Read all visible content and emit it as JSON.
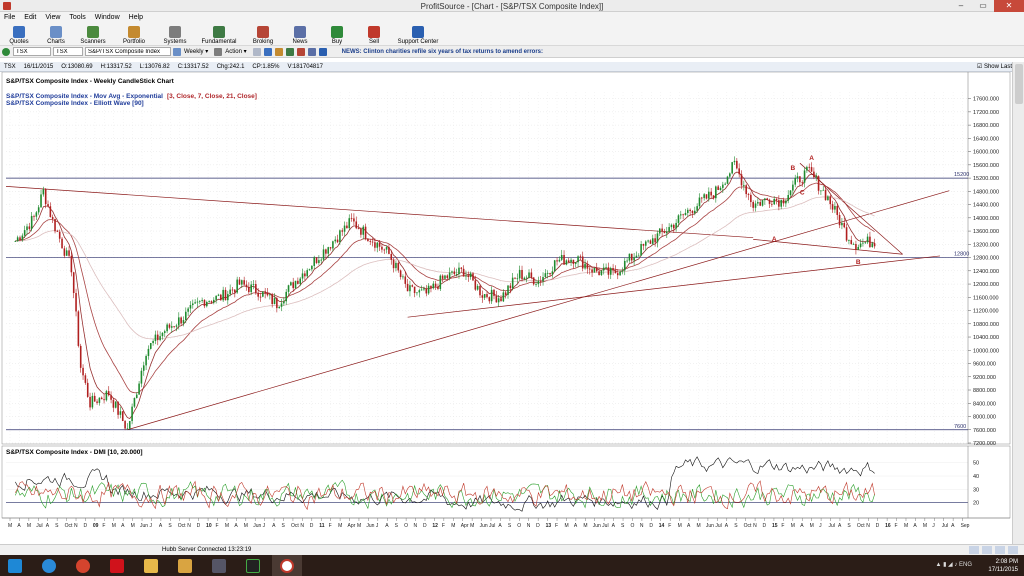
{
  "window": {
    "title": "ProfitSource - [Chart - [S&P/TSX Composite Index]]",
    "controls": [
      "–",
      "▭",
      "✕"
    ]
  },
  "menu": [
    "File",
    "Edit",
    "View",
    "Tools",
    "Window",
    "Help"
  ],
  "toolbar": [
    {
      "label": "Quotes",
      "color": "#3a6fbf"
    },
    {
      "label": "Charts",
      "color": "#6a8fc7"
    },
    {
      "label": "Scanners",
      "color": "#4b8a3e"
    },
    {
      "label": "Portfolio",
      "color": "#c48a2f"
    },
    {
      "label": "Systems",
      "color": "#7d7d7d"
    },
    {
      "label": "Fundamental",
      "color": "#3e7a44"
    },
    {
      "label": "Broking",
      "color": "#b64536"
    },
    {
      "label": "News",
      "color": "#5b6fa6"
    },
    {
      "label": "Buy",
      "color": "#2f8a3a"
    },
    {
      "label": "Sell",
      "color": "#c0392b"
    },
    {
      "label": "Support Center",
      "color": "#2a5fb0"
    }
  ],
  "searchbar": {
    "symbol_value": "TSX",
    "exchange_value": "TSX",
    "name_value": "S&P/TSX Composite Index",
    "period": "Weekly",
    "action": "Action",
    "news": "NEWS: Clinton charities refile six years of tax returns to amend errors:"
  },
  "infobar": {
    "symbol": "TSX",
    "date": "16/11/2015",
    "open": "O:13080.69",
    "high": "H:13317.52",
    "low": "L:13076.82",
    "close": "C:13317.52",
    "change": "Chg:242.1",
    "change_pct": "CP:1.85%",
    "volume": "V:181704817",
    "show_last": "Show Last"
  },
  "chart": {
    "title_lines": [
      "S&P/TSX Composite Index - Weekly CandleStick Chart",
      "S&P/TSX Composite Index - Mov Avg - Exponential",
      "S&P/TSX Composite Index - Elliott Wave [90]"
    ],
    "mavg_params": "[3, Close, 7, Close, 21, Close]",
    "y_ticks": [
      "17600.000",
      "17200.000",
      "16800.000",
      "16400.000",
      "16000.000",
      "15600.000",
      "15200.000",
      "14800.000",
      "14400.000",
      "14000.000",
      "13600.000",
      "13200.000",
      "12800.000",
      "12400.000",
      "12000.000",
      "11600.000",
      "11200.000",
      "10800.000",
      "10400.000",
      "10000.000",
      "9600.000",
      "9200.000",
      "8800.000",
      "8400.000",
      "8000.000",
      "7600.000",
      "7200.000"
    ],
    "level_labels": [
      "15200",
      "12800",
      "7600"
    ],
    "wave_labels": [
      "A",
      "B",
      "C",
      "A",
      "B"
    ],
    "dmi_title": "S&P/TSX Composite Index - DMI [10, 20.000]",
    "dmi_ticks": [
      "50",
      "40",
      "30",
      "20"
    ],
    "x_labels": [
      "M",
      "A",
      "M",
      "Jul",
      "A",
      "S",
      "Oct",
      "N",
      "D",
      "09",
      "F",
      "M",
      "A",
      "M",
      "Jun",
      "J",
      "A",
      "S",
      "Oct",
      "N",
      "D",
      "10",
      "F",
      "M",
      "A",
      "M",
      "Jun",
      "J",
      "A",
      "S",
      "Oct",
      "N",
      "D",
      "11",
      "F",
      "M",
      "Apr",
      "M",
      "Jun",
      "J",
      "A",
      "S",
      "O",
      "N",
      "D",
      "12",
      "F",
      "M",
      "Apr",
      "M",
      "Jun",
      "Jul",
      "A",
      "S",
      "O",
      "N",
      "D",
      "13",
      "F",
      "M",
      "A",
      "M",
      "Jun",
      "Jul",
      "A",
      "S",
      "O",
      "N",
      "D",
      "14",
      "F",
      "M",
      "A",
      "M",
      "Jun",
      "Jul",
      "A",
      "S",
      "Oct",
      "N",
      "D",
      "15",
      "F",
      "M",
      "A",
      "M",
      "J",
      "Jul",
      "A",
      "S",
      "Oct",
      "N",
      "D",
      "16",
      "F",
      "M",
      "A",
      "M",
      "J",
      "Jul",
      "A",
      "Sep"
    ],
    "bold_years": [
      "09",
      "10",
      "11",
      "12",
      "13",
      "14",
      "15",
      "16"
    ]
  },
  "chart_data": {
    "type": "line",
    "title": "S&P/TSX Composite Index - Weekly CandleStick Chart",
    "ylim": [
      7200,
      17800
    ],
    "log_scale": false,
    "horizontal_levels": [
      15200,
      12800,
      7600
    ],
    "series": [
      {
        "name": "S&P/TSX Composite Index",
        "x": [
          "2008-03",
          "2008-05",
          "2008-06",
          "2008-07",
          "2008-09",
          "2008-10",
          "2008-11",
          "2009-01",
          "2009-03",
          "2009-05",
          "2009-07",
          "2009-09",
          "2009-11",
          "2010-01",
          "2010-03",
          "2010-05",
          "2010-07",
          "2010-09",
          "2010-11",
          "2011-01",
          "2011-03",
          "2011-05",
          "2011-07",
          "2011-09",
          "2011-11",
          "2012-01",
          "2012-03",
          "2012-05",
          "2012-07",
          "2012-09",
          "2012-11",
          "2013-01",
          "2013-03",
          "2013-05",
          "2013-07",
          "2013-09",
          "2013-11",
          "2014-01",
          "2014-03",
          "2014-05",
          "2014-06",
          "2014-08",
          "2014-10",
          "2014-12",
          "2015-01",
          "2015-03",
          "2015-04",
          "2015-06",
          "2015-08",
          "2015-09",
          "2015-11"
        ],
        "values": [
          13300,
          14000,
          14800,
          13900,
          12500,
          9500,
          8400,
          8700,
          7600,
          10000,
          10600,
          11000,
          11500,
          11600,
          12000,
          11800,
          11400,
          12100,
          12700,
          13300,
          13900,
          13400,
          12900,
          11800,
          11700,
          12200,
          12400,
          11700,
          11600,
          12300,
          12100,
          12700,
          12800,
          12400,
          12300,
          12800,
          13300,
          13700,
          14200,
          14600,
          14800,
          15600,
          14400,
          14600,
          14500,
          15200,
          15400,
          14600,
          13500,
          13200,
          13300
        ]
      },
      {
        "name": "DMI [10, 20.000]",
        "x": [
          "2008",
          "2009",
          "2010",
          "2011",
          "2012",
          "2013",
          "2014",
          "2015"
        ],
        "values": [
          38,
          28,
          26,
          24,
          20,
          22,
          48,
          46
        ]
      }
    ]
  }
}
